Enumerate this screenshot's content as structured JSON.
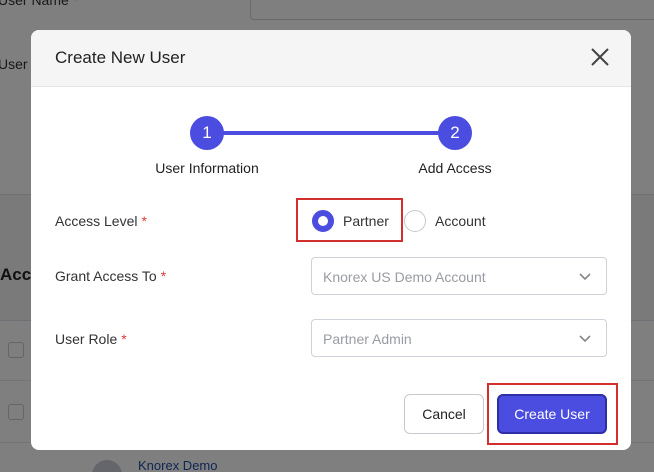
{
  "background": {
    "user_name_label": "User Name *",
    "user_label_partial": "User N",
    "section_title_partial": "Acce",
    "row_link": "Knorex Demo"
  },
  "modal": {
    "title": "Create New User",
    "close_icon": "close-icon",
    "stepper": [
      {
        "number": "1",
        "label": "User Information"
      },
      {
        "number": "2",
        "label": "Add Access"
      }
    ],
    "access_level": {
      "label": "Access Level",
      "required": "*",
      "options": [
        {
          "label": "Partner",
          "checked": true
        },
        {
          "label": "Account",
          "checked": false
        }
      ]
    },
    "grant_access": {
      "label": "Grant Access To",
      "required": "*",
      "value": "Knorex US Demo Account"
    },
    "user_role": {
      "label": "User Role",
      "required": "*",
      "value": "Partner Admin"
    },
    "buttons": {
      "cancel": "Cancel",
      "create": "Create User"
    }
  },
  "colors": {
    "accent": "#4b4ce0",
    "highlight": "#d32f2f",
    "required": "#e53935"
  }
}
